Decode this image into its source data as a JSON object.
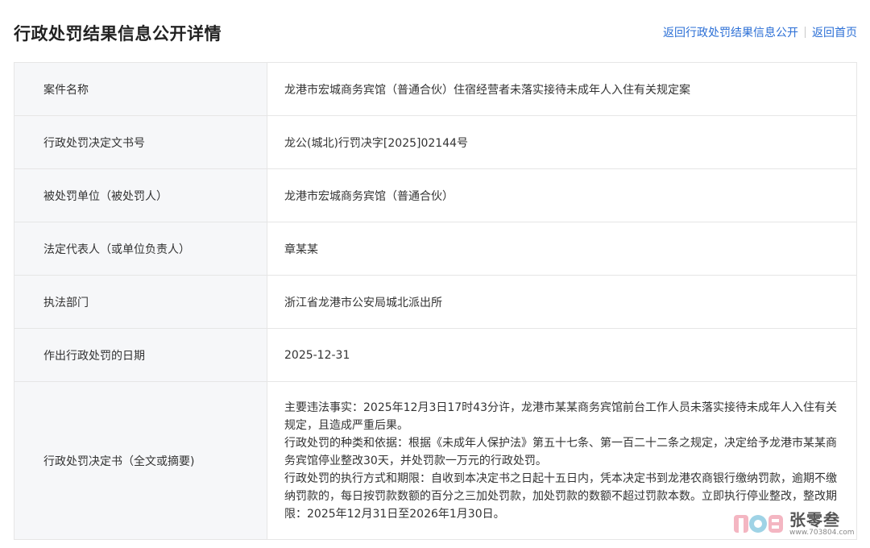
{
  "header": {
    "title": "行政处罚结果信息公开详情",
    "links": {
      "back_list": "返回行政处罚结果信息公开",
      "back_home": "返回首页"
    }
  },
  "rows": [
    {
      "label": "案件名称",
      "value": "龙港市宏城商务宾馆（普通合伙）住宿经营者未落实接待未成年人入住有关规定案"
    },
    {
      "label": "行政处罚决定文书号",
      "value": "龙公(城北)行罚决字[2025]02144号"
    },
    {
      "label": "被处罚单位（被处罚人）",
      "value": "龙港市宏城商务宾馆（普通合伙）"
    },
    {
      "label": "法定代表人（或单位负责人）",
      "value": "章某某"
    },
    {
      "label": "执法部门",
      "value": "浙江省龙港市公安局城北派出所"
    },
    {
      "label": "作出行政处罚的日期",
      "value": "2025-12-31"
    }
  ],
  "decision": {
    "label": "行政处罚决定书（全文或摘要)",
    "paragraphs": [
      "主要违法事实：2025年12月3日17时43分许，龙港市某某商务宾馆前台工作人员未落实接待未成年人入住有关规定，且造成严重后果。",
      "行政处罚的种类和依据：根据《未成年人保护法》第五十七条、第一百二十二条之规定，决定给予龙港市某某商务宾馆停业整改30天，并处罚款一万元的行政处罚。",
      "行政处罚的执行方式和期限：自收到本决定书之日起十五日内，凭本决定书到龙港农商银行缴纳罚款，逾期不缴纳罚款的，每日按罚款数额的百分之三加处罚款，加处罚款的数额不超过罚款本数。立即执行停业整改，整改期限：2025年12月31日至2026年1月30日。"
    ]
  },
  "watermark": {
    "name": "张零叁",
    "url": "www.703804.com"
  },
  "colors": {
    "link": "#2b6fd6",
    "label_bg": "#f6f7f9",
    "border": "#e6e6e6"
  }
}
